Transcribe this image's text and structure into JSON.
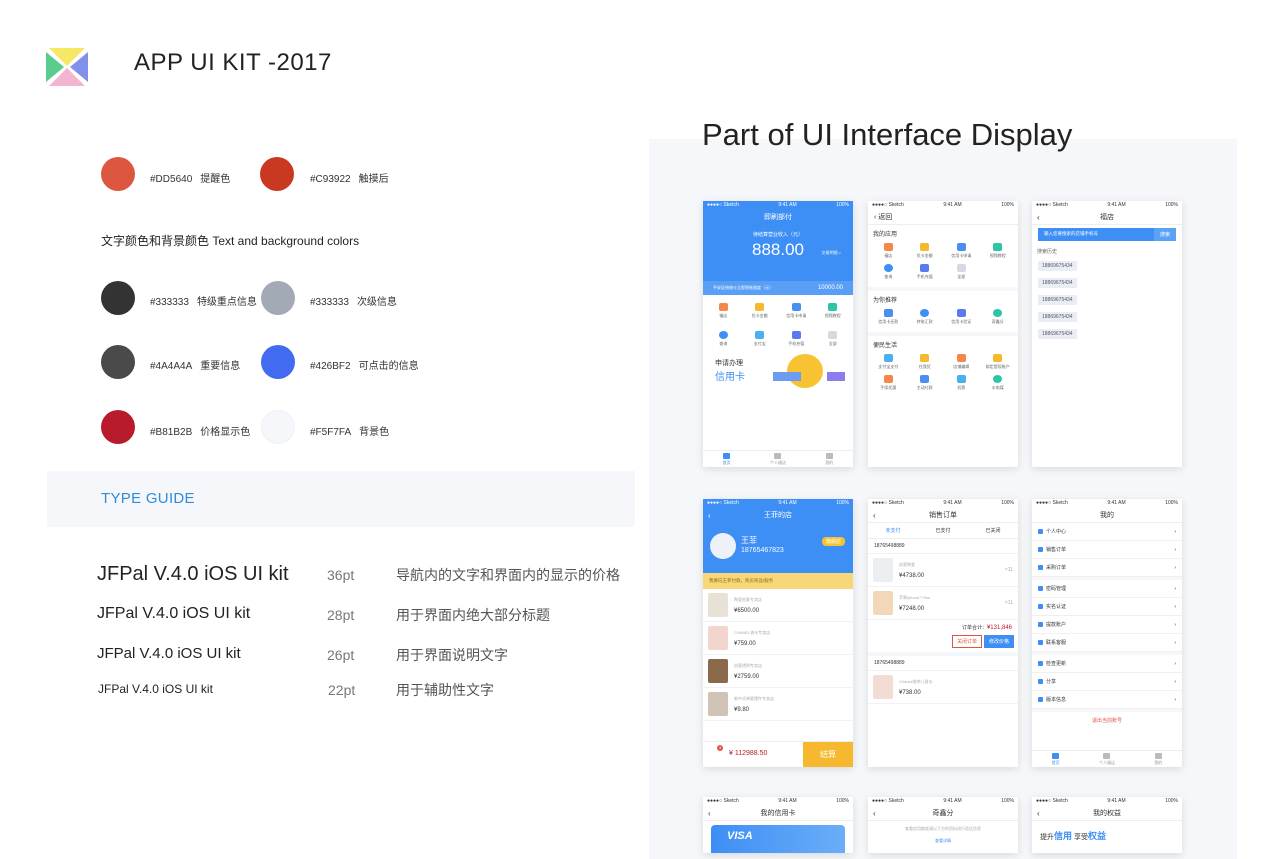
{
  "header": {
    "title": "APP UI KIT  -2017"
  },
  "colors": {
    "primary": [
      {
        "hex": "#DD5640",
        "label": "提醒色",
        "color": "#DD5640"
      },
      {
        "hex": "#C93922",
        "label": "触摸后",
        "color": "#C93922"
      }
    ],
    "section_title": "文字颜色和背景颜色  Text and background colors",
    "text_bg": [
      {
        "hex": "#333333",
        "label": "特级重点信息",
        "color": "#333333"
      },
      {
        "hex": "#333333",
        "label": "次级信息",
        "color": "#A1AAB5"
      },
      {
        "hex": "#4A4A4A",
        "label": "重要信息",
        "color": "#4A4A4A"
      },
      {
        "hex": "#426BF2",
        "label": "可点击的信息",
        "color": "#426BF2"
      },
      {
        "hex": "#B81B2B",
        "label": "价格显示色",
        "color": "#B81B2B"
      },
      {
        "hex": "#F5F7FA",
        "label": "背景色",
        "color": "#F5F7FA"
      }
    ]
  },
  "type_guide": {
    "title": "TYPE GUIDE",
    "rows": [
      {
        "name": "JFPal V.4.0 iOS UI kit",
        "size": "36pt",
        "desc": "导航内的文字和界面内的显示的价格"
      },
      {
        "name": "JFPal V.4.0 iOS UI kit",
        "size": "28pt",
        "desc": "用于界面内绝大部分标题"
      },
      {
        "name": "JFPal V.4.0 iOS UI kit",
        "size": "26pt",
        "desc": "用于界面说明文字"
      },
      {
        "name": "JFPal V.4.0 iOS UI kit",
        "size": "22pt",
        "desc": "用于辅助性文字"
      }
    ]
  },
  "display": {
    "title": "Part of UI Interface Display",
    "status": {
      "left": "●●●●○ Sketch",
      "time": "9:41 AM",
      "battery": "100%"
    },
    "s1": {
      "nav": "即刷部付",
      "label": "待结算营业收入（元）",
      "amount": "888.00",
      "detail": "交易明细 >",
      "sub_label": "平安证借借卡立即到账限度（元）",
      "sub_value": "10000.00",
      "grid": [
        "福店",
        "优卡金额",
        "信用卡申请",
        "视频教程",
        "查询",
        "支付宝",
        "手机充值",
        "全部"
      ],
      "promo_a": "申请办理",
      "promo_b": "信用卡",
      "tabs": [
        "首页",
        "个人福店",
        "我的"
      ]
    },
    "s2": {
      "nav": "返回",
      "sec1": "我的应用",
      "g1": [
        "福店",
        "优卡金额",
        "信用卡申请",
        "视频教程",
        "查询",
        "手机充值",
        "全部"
      ],
      "sec2": "为你推荐",
      "g2": [
        "信用卡还款",
        "转账汇款",
        "信用卡验证",
        "奇鑫分"
      ],
      "sec3": "便民生活",
      "g3": [
        "支付宝支付",
        "任我货",
        "店铺编辑",
        "绑定提现账户",
        "手续优惠",
        "主动付款",
        "机票",
        "水电煤"
      ]
    },
    "s3": {
      "nav": "福店",
      "placeholder": "输入您要搜索的店铺手机号",
      "btn": "搜索",
      "history": "搜索历史",
      "items": [
        "18869675434",
        "18869675434",
        "18869675434",
        "18869675434",
        "18869675434"
      ]
    },
    "s4": {
      "nav": "王菲的店",
      "name": "王菲",
      "badge": "旗舰店",
      "phone": "18765467823",
      "notice": "我要向王菲付款，购买商品/服务",
      "items": [
        {
          "t": "陶瓷创意专卖店",
          "p": "¥6500.00"
        },
        {
          "t": "CHANEL香水专卖店",
          "p": "¥759.00"
        },
        {
          "t": "创意透明专卖店",
          "p": "¥2759.00"
        },
        {
          "t": "新中式禅意摆件专卖店",
          "p": "¥9.80"
        }
      ],
      "cart_badge": "3",
      "total": "112988.50",
      "pay": "结算"
    },
    "s5": {
      "nav": "销售订单",
      "tabs": [
        "未支付",
        "已支付",
        "已关闭"
      ],
      "user1": "18765498889",
      "o1": {
        "t": "创意陶瓷",
        "p": "¥4738.00",
        "q": "×11"
      },
      "o2": {
        "t": "苹果iphone7 Plus",
        "p": "¥7248.00",
        "q": "×11"
      },
      "total_label": "订单合计：",
      "total": "¥131,846",
      "close": "关闭订单",
      "edit": "修改价格",
      "user2": "18765498889",
      "o3": {
        "t": "Chanel/香奈儿香水",
        "p": "¥738.00"
      }
    },
    "s6": {
      "nav": "我的",
      "rows": [
        "个人中心",
        "销售订单",
        "采购订单",
        "密码管理",
        "实名认证",
        "提款账户",
        "联系客服",
        "检查更新",
        "分享",
        "版本信息"
      ],
      "logout": "退出当前账号",
      "tabs": [
        "首页",
        "个人福店",
        "我的"
      ]
    },
    "s7": {
      "nav": "我的信用卡",
      "card": "VISA"
    },
    "s8": {
      "nav": "奇鑫分",
      "text": "查看信用额度请以下方的资料进行验证信息",
      "link": "查看详情"
    },
    "s9": {
      "nav": "我的权益",
      "banner_a": "提升",
      "banner_b": "信用",
      "banner_c": "享受",
      "banner_d": "权益"
    }
  }
}
